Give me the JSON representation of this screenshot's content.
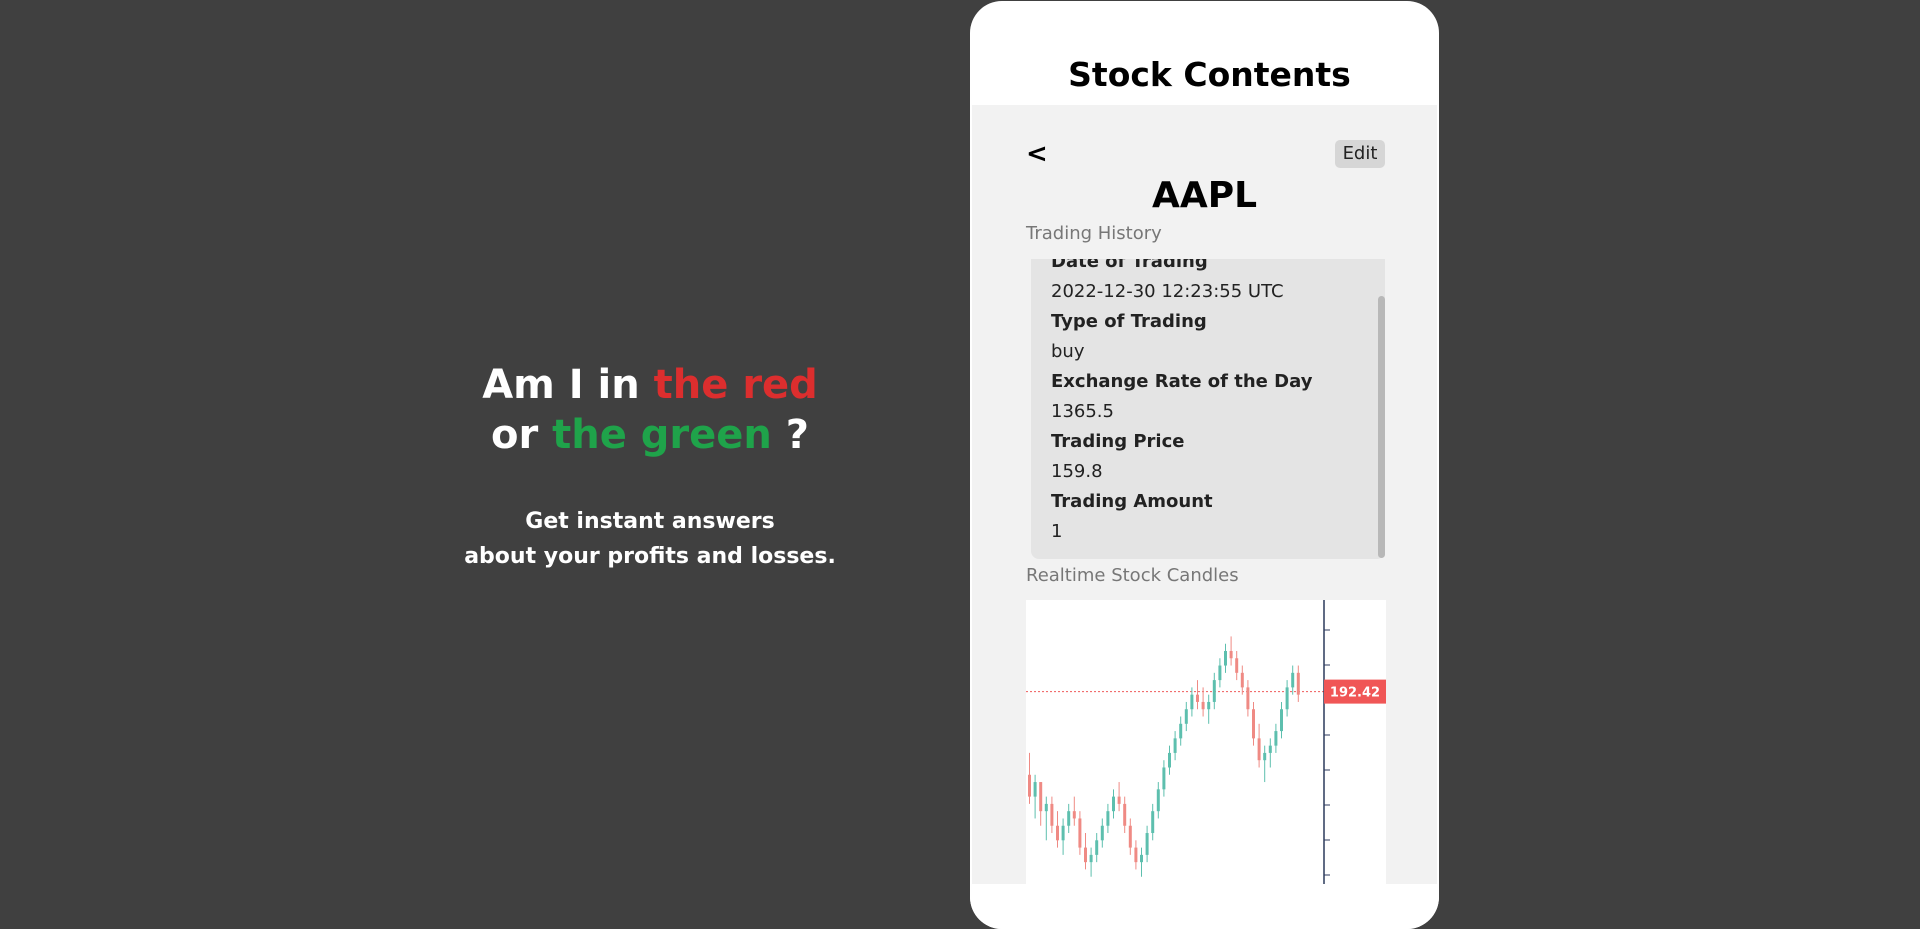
{
  "hero": {
    "line1_prefix": "Am I in ",
    "line1_highlight": "the red",
    "line2_prefix": "or ",
    "line2_highlight": "the green",
    "line2_suffix": " ?",
    "sub_line1": "Get instant answers",
    "sub_line2": "about your profits and losses."
  },
  "phone": {
    "title": "Stock Contents",
    "back_label": "<",
    "edit_label": "Edit",
    "ticker": "AAPL",
    "history_label": "Trading History",
    "history": [
      {
        "label": "Date of Trading",
        "value": "2022-12-30 12:23:55 UTC"
      },
      {
        "label": "Type of Trading",
        "value": "buy"
      },
      {
        "label": "Exchange Rate of the Day",
        "value": "1365.5"
      },
      {
        "label": "Trading Price",
        "value": "159.8"
      },
      {
        "label": "Trading Amount",
        "value": "1"
      }
    ],
    "candles_label": "Realtime Stock Candles",
    "current_price": "192.42"
  },
  "colors": {
    "red": "#dc2e2e",
    "green": "#1fa34a",
    "candle_up": "#5dbfae",
    "candle_down": "#ef8a84",
    "price_tag": "#f05656"
  },
  "chart_data": {
    "type": "candlestick",
    "current_price": 192.42,
    "candles": [
      [
        181,
        184,
        177,
        178
      ],
      [
        178,
        181,
        175,
        180
      ],
      [
        180,
        180,
        174,
        176
      ],
      [
        176,
        178,
        172,
        177
      ],
      [
        177,
        178,
        173,
        174
      ],
      [
        174,
        176,
        171,
        172
      ],
      [
        172,
        175,
        170,
        174
      ],
      [
        174,
        177,
        173,
        176
      ],
      [
        176,
        178,
        174,
        175
      ],
      [
        175,
        176,
        170,
        171
      ],
      [
        171,
        173,
        168,
        169
      ],
      [
        169,
        171,
        167,
        170
      ],
      [
        170,
        173,
        169,
        172
      ],
      [
        172,
        175,
        171,
        174
      ],
      [
        174,
        177,
        173,
        176
      ],
      [
        176,
        179,
        175,
        178
      ],
      [
        178,
        180,
        176,
        177
      ],
      [
        177,
        178,
        173,
        174
      ],
      [
        174,
        175,
        170,
        171
      ],
      [
        171,
        172,
        168,
        169
      ],
      [
        169,
        171,
        167,
        170
      ],
      [
        170,
        174,
        169,
        173
      ],
      [
        173,
        177,
        172,
        176
      ],
      [
        176,
        180,
        175,
        179
      ],
      [
        179,
        183,
        178,
        182
      ],
      [
        182,
        185,
        181,
        184
      ],
      [
        184,
        187,
        183,
        186
      ],
      [
        186,
        189,
        185,
        188
      ],
      [
        188,
        191,
        187,
        190
      ],
      [
        190,
        193,
        189,
        192
      ],
      [
        192,
        194,
        190,
        191
      ],
      [
        191,
        193,
        189,
        190
      ],
      [
        190,
        192,
        188,
        191
      ],
      [
        191,
        195,
        190,
        194
      ],
      [
        194,
        197,
        193,
        196
      ],
      [
        196,
        199,
        195,
        198
      ],
      [
        198,
        200,
        196,
        197
      ],
      [
        197,
        198,
        194,
        195
      ],
      [
        195,
        196,
        192,
        193
      ],
      [
        193,
        194,
        189,
        190
      ],
      [
        190,
        191,
        185,
        186
      ],
      [
        186,
        188,
        182,
        183
      ],
      [
        183,
        185,
        180,
        184
      ],
      [
        184,
        186,
        182,
        185
      ],
      [
        185,
        188,
        184,
        187
      ],
      [
        187,
        191,
        186,
        190
      ],
      [
        190,
        194,
        189,
        193
      ],
      [
        193,
        196,
        192,
        195
      ],
      [
        195,
        196,
        191,
        192
      ]
    ],
    "ylim": [
      166,
      205
    ]
  }
}
